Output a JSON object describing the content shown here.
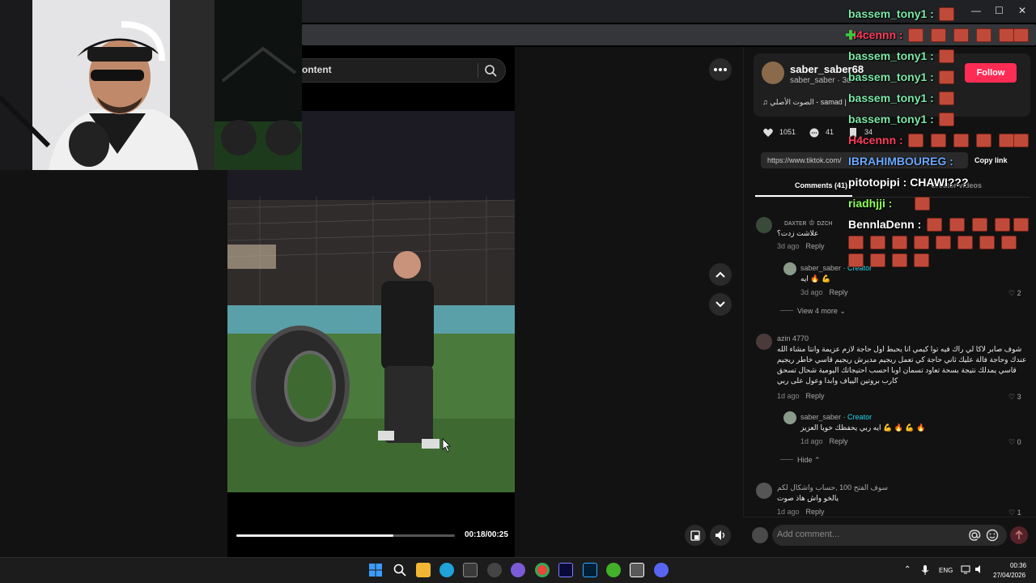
{
  "browser": {
    "minimize_glyph": "—",
    "maximize_glyph": "☐",
    "close_glyph": "✕"
  },
  "search": {
    "text": "ontent"
  },
  "video": {
    "time": "00:18/00:25",
    "progress_fraction": 0.72
  },
  "author": {
    "name": "saber_saber68",
    "sub": "saber_saber · 3d",
    "music": "♫ الصوت الأصلي - samad |",
    "follow_label": "Follow"
  },
  "stats": {
    "likes": "1051",
    "comments": "41",
    "shares": "34"
  },
  "link": {
    "url": "https://www.tiktok.com/",
    "copy_label": "Copy link"
  },
  "tabs": {
    "comments": "Comments (41)",
    "creator_videos": "Creator videos"
  },
  "comments": [
    {
      "user": "ᴅᴀxᴛᴇʀ ♔ ᴅᴢᴄʜ",
      "text": "علاشت زدت؟",
      "time": "3d ago",
      "reply": "Reply",
      "replies": [
        {
          "user": "saber_saber",
          "creator": "· Creator",
          "text": "ايه 🔥 💪",
          "time": "3d ago",
          "reply": "Reply",
          "likes": "2"
        }
      ],
      "view_more": "View 4 more"
    },
    {
      "user": "azin 4770",
      "lines": [
        "شوف صابر لاكا لي راك فيه توا كيمي انا يحبط اول حاجة لازم عزيمة وانتا مشاء الله",
        "عندك وحاجة فالة عليك ثاني حاجة كي تعمل ريجيم مديرش ريجيم قاسي خاطر ريجيم",
        "قاسي يمدلك نتيجة بسحة تعاود تسمان اوبا احسب احتيجاتك اليومية شحال تسحق",
        "كارب بروتين اليياف وابدا وعول على ربي"
      ],
      "time": "1d ago",
      "reply": "Reply",
      "likes": "3",
      "replies": [
        {
          "user": "saber_saber",
          "creator": "· Creator",
          "text": "ايه ربي يحفظك خويا العزيز 💪 🔥 💪 🔥",
          "time": "1d ago",
          "reply": "Reply",
          "likes": "0"
        }
      ],
      "hide": "Hide"
    },
    {
      "user": "سوف الفتح 100 ,حساب واشكال لكم",
      "text": "يالخو واش هاذ صوت",
      "time": "1d ago",
      "reply": "Reply",
      "likes": "1"
    }
  ],
  "add_comment": {
    "placeholder": "Add comment..."
  },
  "chat": [
    {
      "user": "bassem_tony1 :",
      "color": "#7be8a8"
    },
    {
      "user": "H4cennn :",
      "color": "#ff3b5c"
    },
    {
      "user": "bassem_tony1 :",
      "color": "#7be8a8"
    },
    {
      "user": "bassem_tony1 :",
      "color": "#7be8a8"
    },
    {
      "user": "bassem_tony1 :",
      "color": "#7be8a8"
    },
    {
      "user": "bassem_tony1 :",
      "color": "#7be8a8"
    },
    {
      "user": "H4cennn :",
      "color": "#ff3b5c"
    },
    {
      "user": "IBRAHIMBOUREG :",
      "color": "#6aa8ff"
    },
    {
      "user": "pitotopipi : CHAWI???",
      "color": "#ffffff"
    },
    {
      "user": "riadhjji :",
      "color": "#8cff5a"
    },
    {
      "user": "BennlaDenn :",
      "color": "#ffffff"
    }
  ],
  "tray": {
    "lang": "ENG",
    "time": "00:36",
    "date": "27/04/2026"
  }
}
